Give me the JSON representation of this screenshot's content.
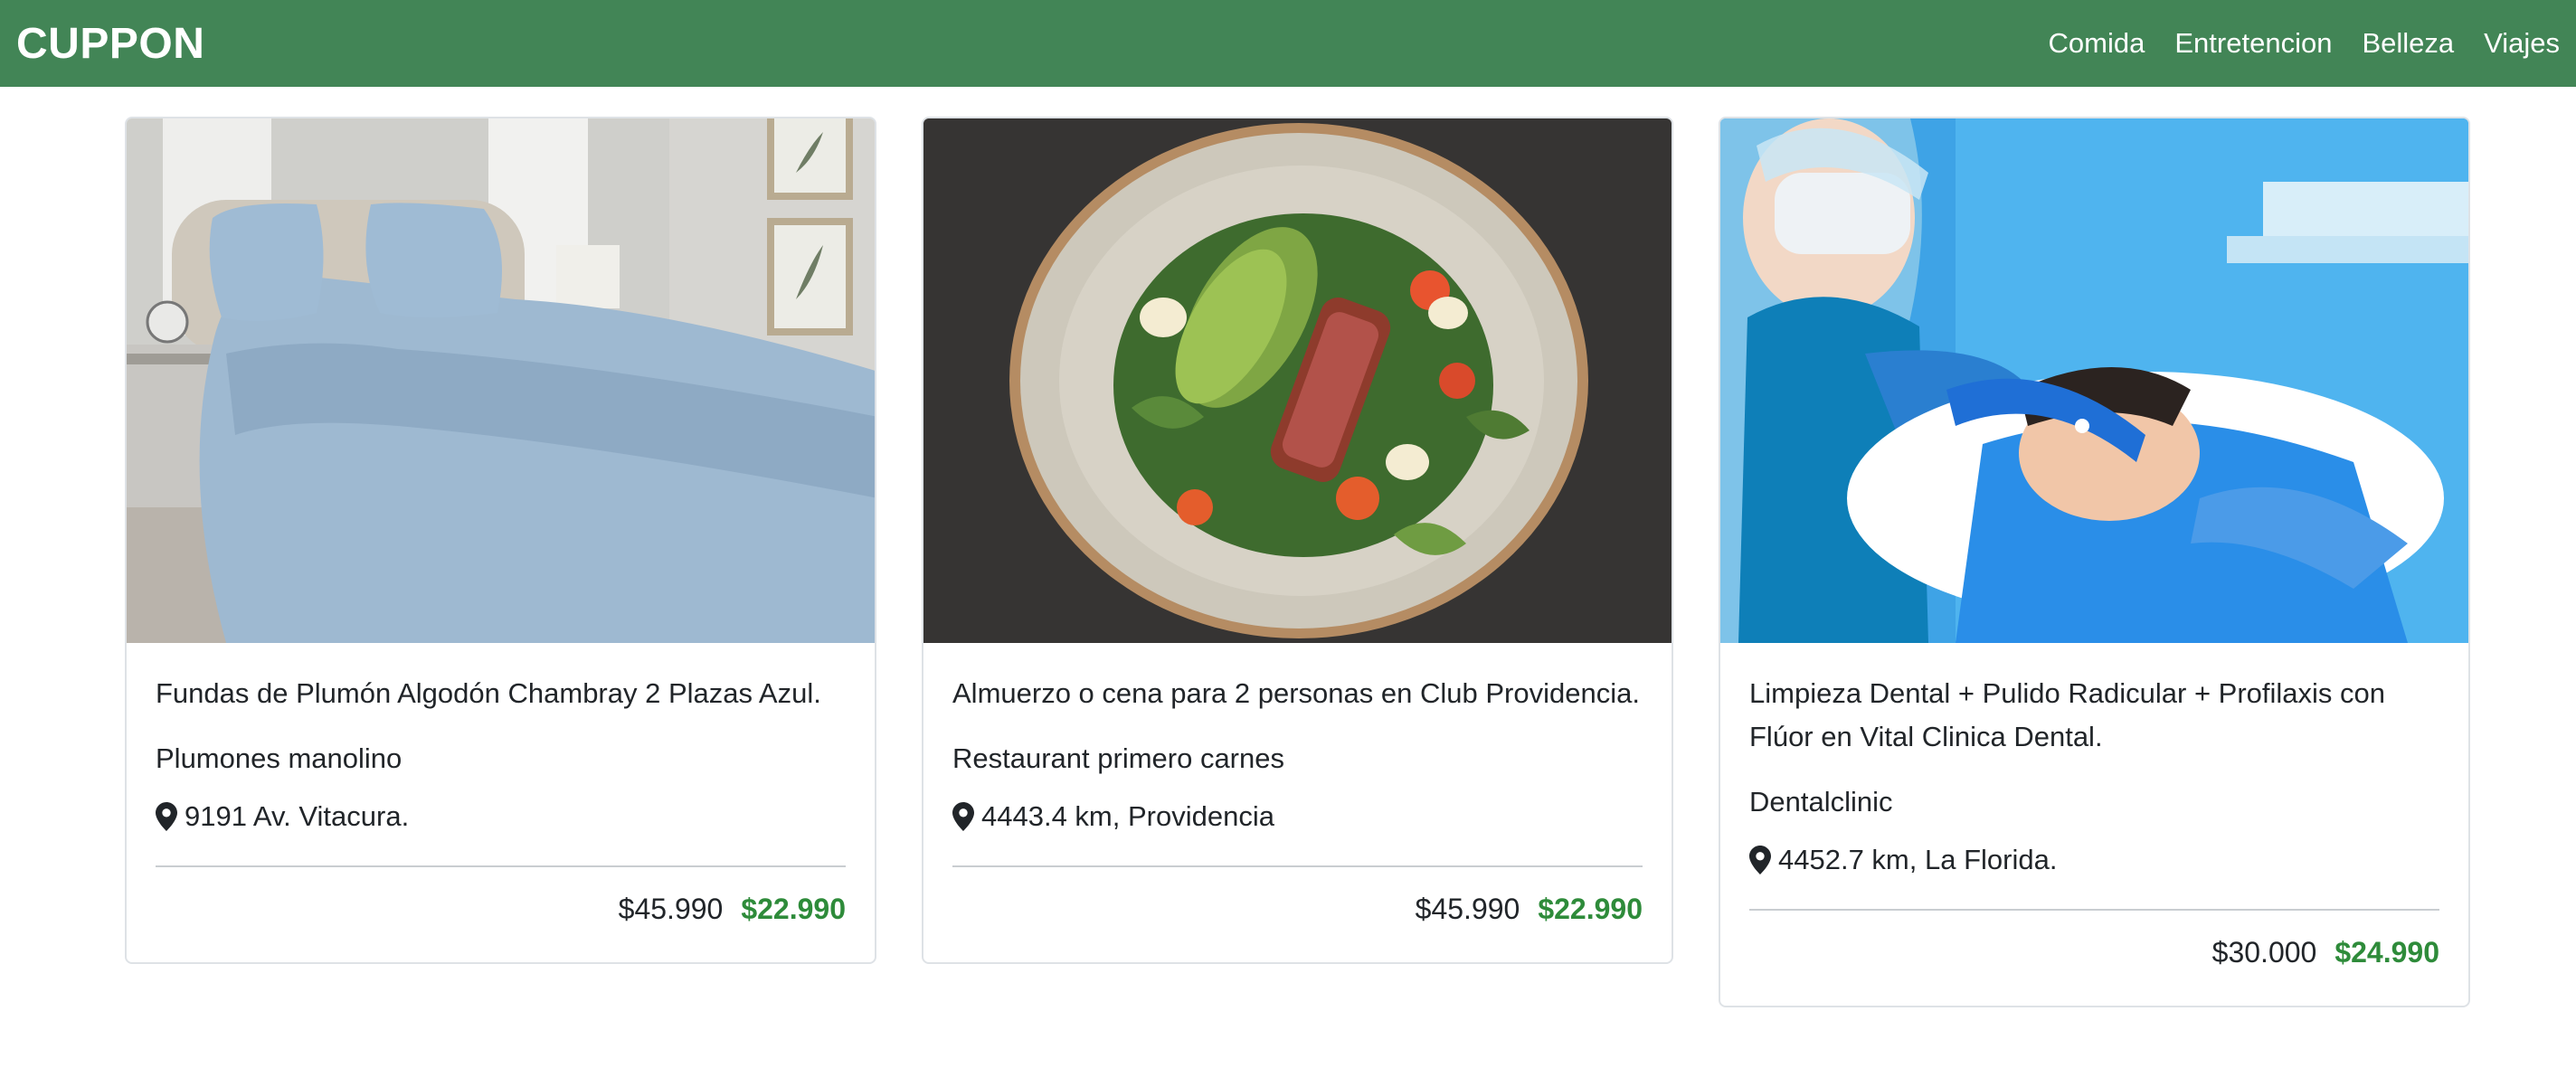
{
  "brand": "CUPPON",
  "nav": [
    "Comida",
    "Entretencion",
    "Belleza",
    "Viajes"
  ],
  "colors": {
    "navbar": "#428556",
    "price_accent": "#2e8b3a"
  },
  "cards": [
    {
      "image": "bedding-image",
      "title": "Fundas de Plumón Algodón Chambray 2 Plazas Azul.",
      "vendor": "Plumones manolino",
      "location": "9191 Av. Vitacura.",
      "old_price": "$45.990",
      "new_price": "$22.990"
    },
    {
      "image": "salad-image",
      "title": "Almuerzo o cena para 2 personas en Club Providencia.",
      "vendor": "Restaurant primero carnes",
      "location": "4443.4 km, Providencia",
      "old_price": "$45.990",
      "new_price": "$22.990"
    },
    {
      "image": "dental-image",
      "title": "Limpieza Dental + Pulido Radicular + Profilaxis con Flúor en Vital Clinica Dental.",
      "vendor": "Dentalclinic",
      "location": "4452.7 km, La Florida.",
      "old_price": "$30.000",
      "new_price": "$24.990"
    }
  ]
}
